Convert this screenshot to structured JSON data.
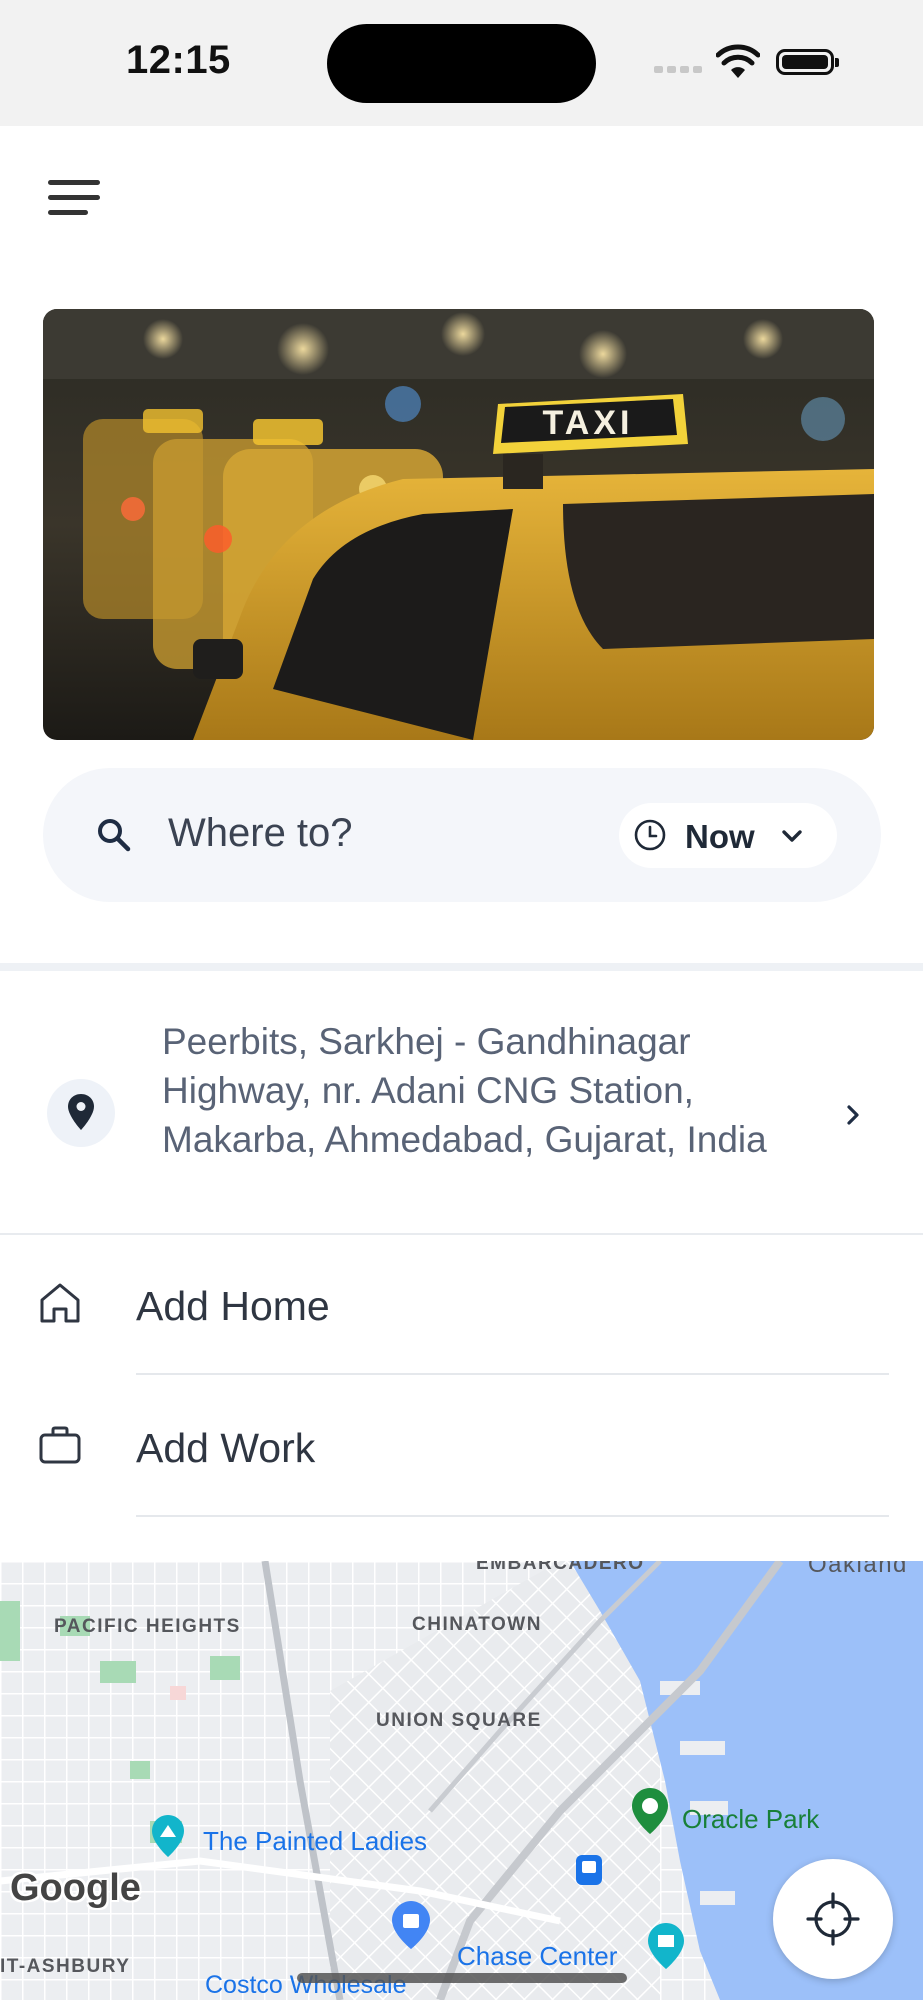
{
  "status_bar": {
    "time": "12:15"
  },
  "header": {
    "menu_icon": "hamburger-menu-icon"
  },
  "banner": {
    "sign_text": "TAXI"
  },
  "search": {
    "placeholder": "Where to?",
    "icon": "search-icon",
    "time_option": "Now",
    "time_icon": "clock-icon",
    "chevron_icon": "chevron-down-icon"
  },
  "recent_location": {
    "icon": "location-pin-icon",
    "address": "Peerbits, Sarkhej - Gandhinagar Highway, nr. Adani CNG Station, Makarba, Ahmedabad, Gujarat, India",
    "chevron_icon": "chevron-right-icon"
  },
  "saved_places": [
    {
      "icon": "home-icon",
      "label": "Add Home"
    },
    {
      "icon": "briefcase-icon",
      "label": "Add Work"
    }
  ],
  "map": {
    "neighborhoods": [
      "PACIFIC HEIGHTS",
      "CHINATOWN",
      "UNION SQUARE",
      "IT-ASHBURY",
      "EMBARCADERO",
      "Oakland"
    ],
    "pois": [
      "The Painted Ladies",
      "Oracle Park",
      "Chase Center",
      "Costco Wholesale"
    ],
    "attribution": "Google",
    "locate_icon": "crosshair-locate-icon",
    "colors": {
      "water": "#9cc0f9",
      "park": "#a8dab5",
      "land": "#eef0f3"
    }
  }
}
